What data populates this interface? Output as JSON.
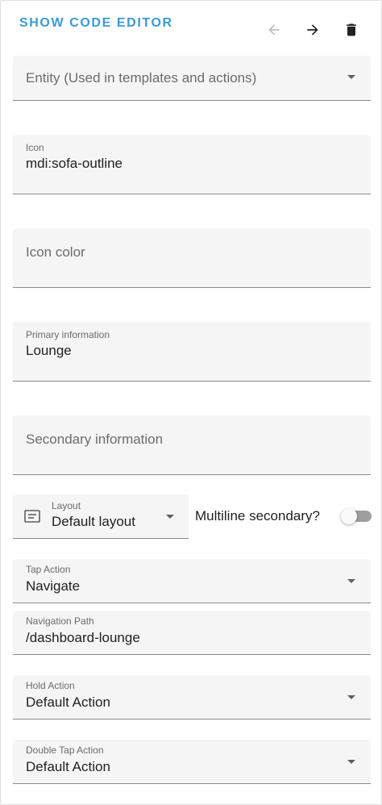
{
  "toolbar": {
    "show_code_editor": "SHOW CODE EDITOR",
    "back_icon": "arrow-left-icon",
    "forward_icon": "arrow-right-icon",
    "delete_icon": "trash-icon"
  },
  "fields": {
    "entity": {
      "label": "Entity (Used in templates and actions)"
    },
    "icon": {
      "label": "Icon",
      "value": "mdi:sofa-outline"
    },
    "icon_color": {
      "label": "Icon color"
    },
    "primary": {
      "label": "Primary information",
      "value": "Lounge"
    },
    "secondary": {
      "label": "Secondary information"
    },
    "layout": {
      "label": "Layout",
      "value": "Default layout",
      "icon": "layout-list-icon"
    },
    "multiline": {
      "label": "Multiline secondary?",
      "checked": false
    },
    "tap_action": {
      "label": "Tap Action",
      "value": "Navigate"
    },
    "navigation_path": {
      "label": "Navigation Path",
      "value": "/dashboard-lounge"
    },
    "hold_action": {
      "label": "Hold Action",
      "value": "Default Action"
    },
    "double_tap_action": {
      "label": "Double Tap Action",
      "value": "Default Action"
    }
  },
  "colors": {
    "accent": "#3a9ad9",
    "field_bg": "#f5f5f5",
    "disabled_icon": "#bdbdbd",
    "toggle_off": "#9e9e9e"
  }
}
